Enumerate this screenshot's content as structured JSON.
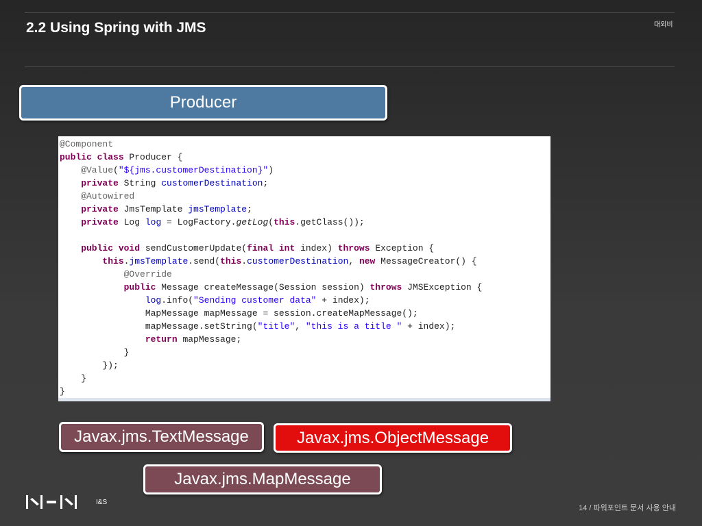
{
  "header": {
    "title": "2.2  Using Spring with JMS",
    "classification": "대외비"
  },
  "boxes": {
    "producer": "Producer",
    "text_message": "Javax.jms.TextMessage",
    "object_message": "Javax.jms.ObjectMessage",
    "map_message": "Javax.jms.MapMessage"
  },
  "code": [
    [
      [
        "@Component",
        "an"
      ]
    ],
    [
      [
        "public class",
        "kw"
      ],
      [
        " Producer {",
        ""
      ]
    ],
    [
      [
        "    @Value",
        "an"
      ],
      [
        "(",
        ""
      ],
      [
        "\"${jms.customerDestination}\"",
        "st"
      ],
      [
        ")",
        ""
      ]
    ],
    [
      [
        "    private",
        "kw"
      ],
      [
        " String ",
        ""
      ],
      [
        "customerDestination",
        "fd"
      ],
      [
        ";",
        ""
      ]
    ],
    [
      [
        "    @Autowired",
        "an"
      ]
    ],
    [
      [
        "    private",
        "kw"
      ],
      [
        " JmsTemplate ",
        ""
      ],
      [
        "jmsTemplate",
        "fd"
      ],
      [
        ";",
        ""
      ]
    ],
    [
      [
        "    private",
        "kw"
      ],
      [
        " Log ",
        ""
      ],
      [
        "log",
        "fd"
      ],
      [
        " = LogFactory.",
        ""
      ],
      [
        "getLog",
        "it"
      ],
      [
        "(",
        ""
      ],
      [
        "this",
        "kw"
      ],
      [
        ".getClass());",
        ""
      ]
    ],
    [],
    [
      [
        "    public void",
        "kw"
      ],
      [
        " sendCustomerUpdate(",
        ""
      ],
      [
        "final int",
        "kw"
      ],
      [
        " index) ",
        ""
      ],
      [
        "throws",
        "kw"
      ],
      [
        " Exception {",
        ""
      ]
    ],
    [
      [
        "        this",
        "kw"
      ],
      [
        ".",
        ""
      ],
      [
        "jmsTemplate",
        "fd"
      ],
      [
        ".send(",
        ""
      ],
      [
        "this",
        "kw"
      ],
      [
        ".",
        ""
      ],
      [
        "customerDestination",
        "fd"
      ],
      [
        ", ",
        ""
      ],
      [
        "new",
        "kw"
      ],
      [
        " MessageCreator() {",
        ""
      ]
    ],
    [
      [
        "            @Override",
        "an"
      ]
    ],
    [
      [
        "            public",
        "kw"
      ],
      [
        " Message createMessage(Session session) ",
        ""
      ],
      [
        "throws",
        "kw"
      ],
      [
        " JMSException {",
        ""
      ]
    ],
    [
      [
        "                log",
        "fd"
      ],
      [
        ".info(",
        ""
      ],
      [
        "\"Sending customer data\"",
        "st"
      ],
      [
        " + index);",
        ""
      ]
    ],
    [
      [
        "                MapMessage mapMessage = session.createMapMessage();",
        ""
      ]
    ],
    [
      [
        "                mapMessage.setString(",
        ""
      ],
      [
        "\"title\"",
        "st"
      ],
      [
        ", ",
        ""
      ],
      [
        "\"this is a title \"",
        "st"
      ],
      [
        " + index);",
        ""
      ]
    ],
    [
      [
        "                return",
        "kw"
      ],
      [
        " mapMessage;",
        ""
      ]
    ],
    [
      [
        "            }",
        ""
      ]
    ],
    [
      [
        "        });",
        ""
      ]
    ],
    [
      [
        "    }",
        ""
      ]
    ],
    [
      [
        "}",
        ""
      ]
    ]
  ],
  "footer": {
    "logo_text": "I&S",
    "page": "14 / 파워포인트 문서 사용 안내"
  }
}
